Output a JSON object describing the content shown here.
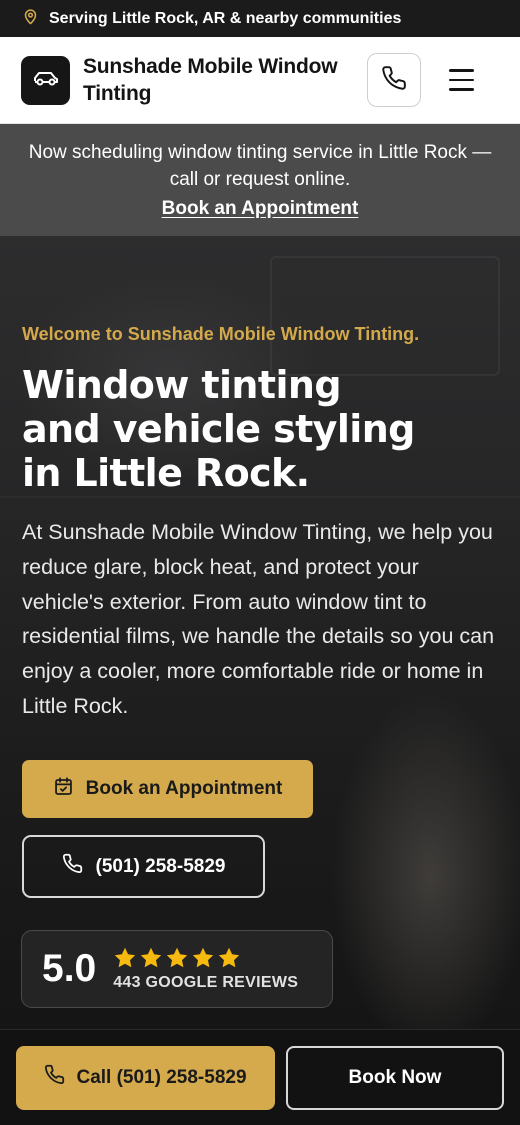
{
  "topbar": {
    "location_text": "Serving Little Rock, AR & nearby communities",
    "icon": "map-pin-icon"
  },
  "header": {
    "brand_name": "Sunshade Mobile Window Tinting",
    "logo_icon": "car-icon",
    "phone_icon": "phone-icon",
    "menu_icon": "hamburger-menu-icon"
  },
  "announcement": {
    "text": "Now scheduling window tinting service in Little Rock — call or request online.",
    "link_label": "Book an Appointment"
  },
  "hero": {
    "welcome": "Welcome to Sunshade Mobile Window Tinting.",
    "headline_lines": [
      "Window tinting",
      "and vehicle styling",
      "in Little Rock."
    ],
    "description": "At Sunshade Mobile Window Tinting, we help you reduce glare, block heat, and protect your vehicle's exterior. From auto window tint to residential films, we handle the details so you can enjoy a cooler, more comfortable ride or home in Little Rock.",
    "book_button_label": "Book an Appointment",
    "book_button_icon": "calendar-check-icon",
    "phone_button_label": "(501) 258-5829",
    "phone_button_icon": "phone-icon"
  },
  "reviews": {
    "score": "5.0",
    "stars": 5,
    "count_label": "443 GOOGLE REVIEWS"
  },
  "bottom_bar": {
    "call_label": "Call (501) 258-5829",
    "book_label": "Book Now"
  },
  "colors": {
    "accent_gold": "#d4aa4c",
    "dark": "#121212",
    "announce_bg": "#4b4b4b",
    "welcome_text": "#d4a94c",
    "star": "#f5b90f"
  }
}
